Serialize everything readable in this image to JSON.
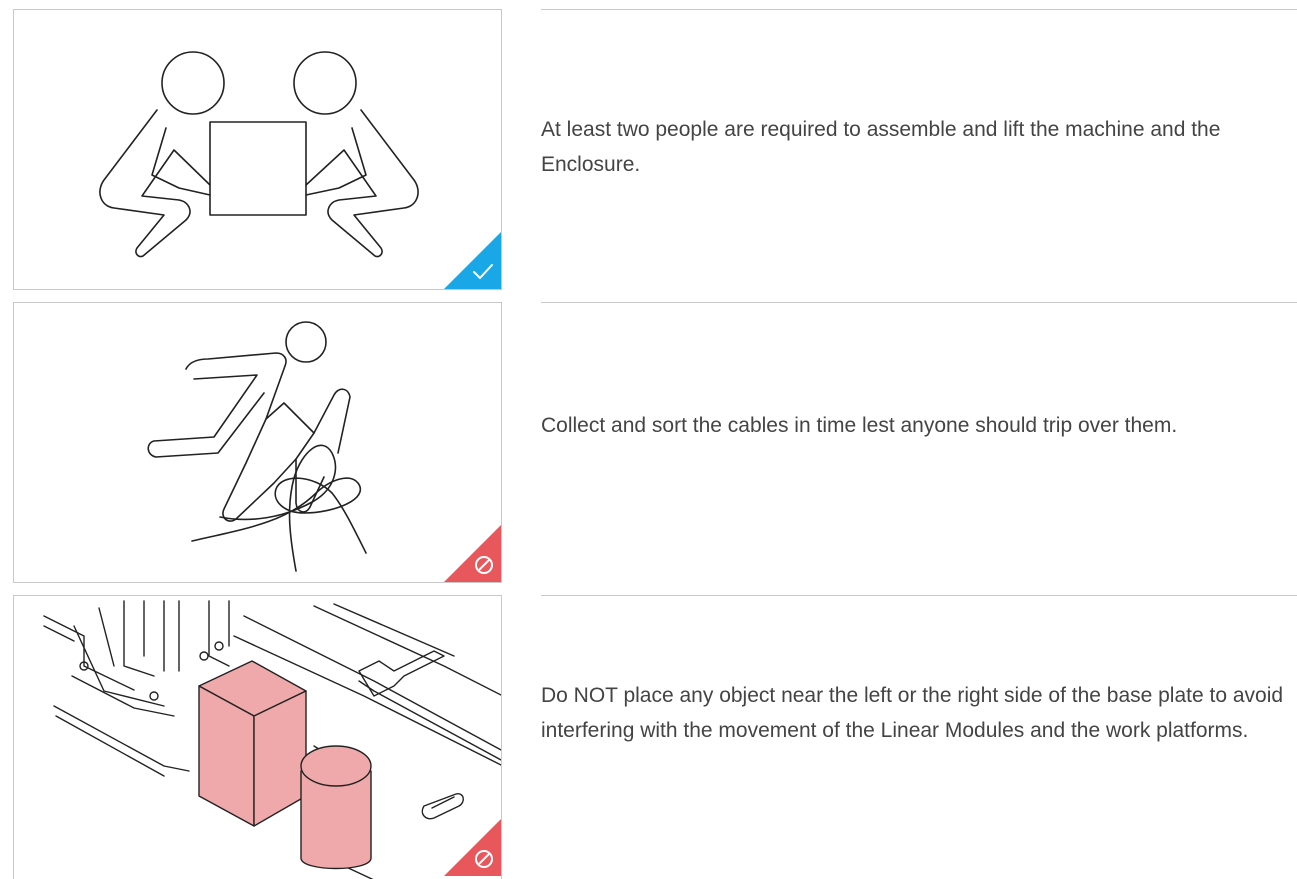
{
  "colors": {
    "ok_badge": "#1aa7e8",
    "prohibited_badge": "#e8575c",
    "object_fill": "#f0a9ab",
    "line": "#222222",
    "border": "#c8c8c8"
  },
  "items": [
    {
      "illustration": "two-people-lifting-box",
      "badge": "checkmark-icon",
      "caption": "At least two people are required to assemble and lift the machine and the Enclosure."
    },
    {
      "illustration": "person-tripping-over-cables",
      "badge": "prohibited-icon",
      "caption": "Collect and sort the cables in time lest anyone should trip over them."
    },
    {
      "illustration": "objects-near-base-plate",
      "badge": "prohibited-icon",
      "caption": "Do NOT place any object near the left or the right side of the base plate to avoid interfering with the movement of the Linear Modules and the work platforms."
    }
  ]
}
